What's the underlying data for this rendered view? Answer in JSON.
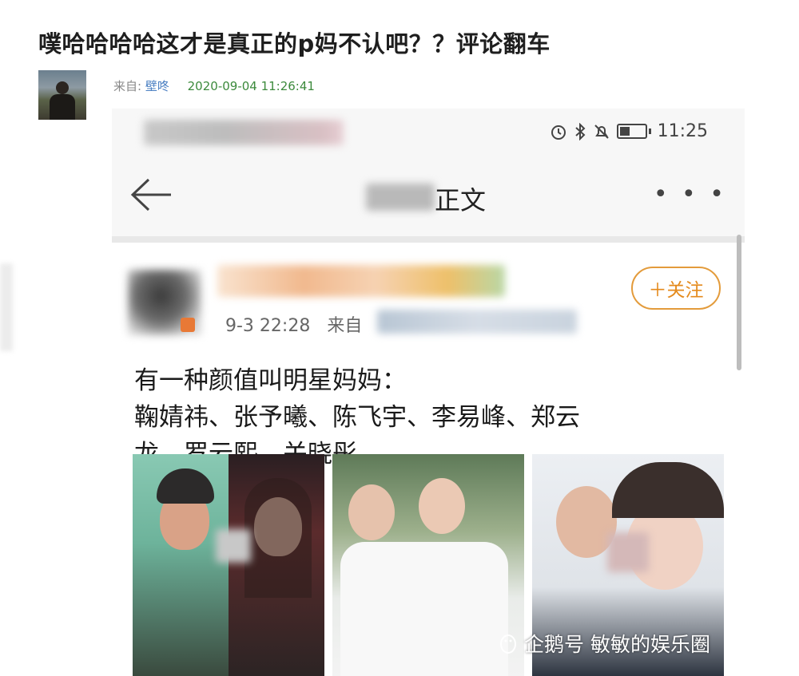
{
  "article": {
    "title": "噗哈哈哈哈这才是真正的p妈不认吧？？评论翻车",
    "source_label": "来自:",
    "source_name": "壁咚",
    "timestamp": "2020-09-04 11:26:41"
  },
  "phone": {
    "status_time": "11:25",
    "status_icons": [
      "alarm-icon",
      "bluetooth-icon",
      "mute-icon",
      "battery-icon"
    ],
    "nav_title": "正文",
    "more_label": "• • •"
  },
  "post": {
    "follow_label": "＋关注",
    "time": "9-3 22:28",
    "source_label": "来自",
    "lines": [
      "有一种颜值叫明星妈妈：",
      "鞠婧祎、张予曦、陈飞宇、李易峰、郑云",
      "龙、罗云熙、关晓彤"
    ]
  },
  "watermark": {
    "text": "企鹅号 敏敏的娱乐圈"
  },
  "colors": {
    "follow_accent": "#e39b3b",
    "source_link": "#4a7fc2",
    "timestamp_green": "#3c8a3c"
  }
}
